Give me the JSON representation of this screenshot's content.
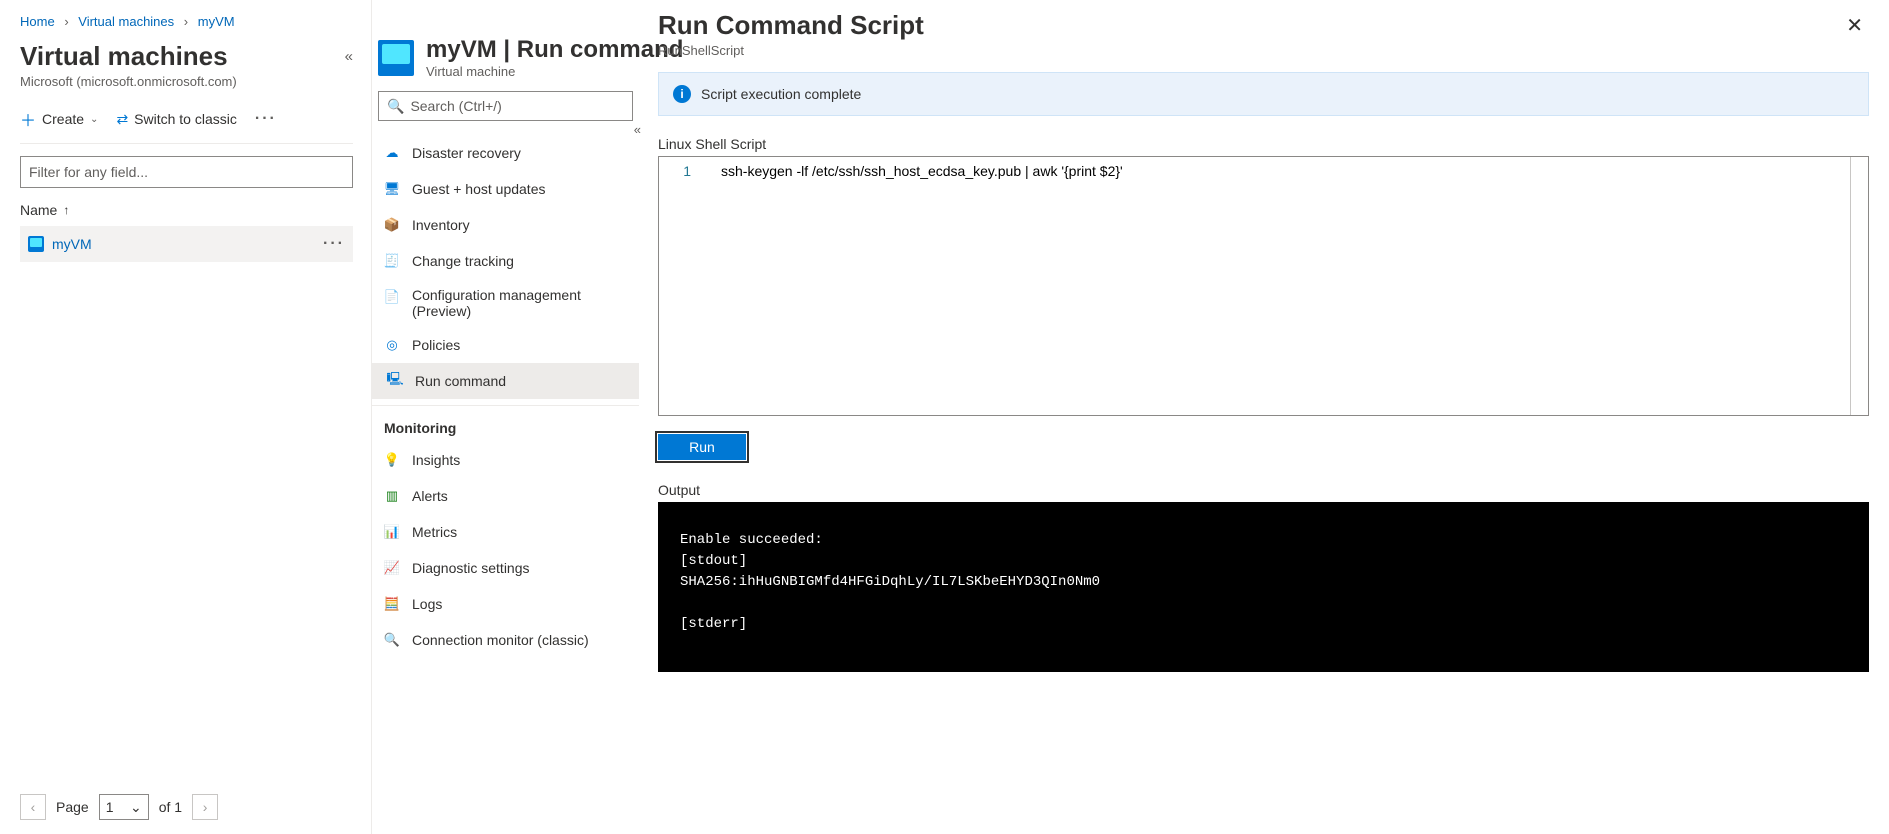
{
  "breadcrumb": {
    "home": "Home",
    "vms": "Virtual machines",
    "vm": "myVM"
  },
  "vmlist": {
    "title": "Virtual machines",
    "subtitle": "Microsoft (microsoft.onmicrosoft.com)",
    "toolbar": {
      "create": "Create",
      "switch": "Switch to classic"
    },
    "filter_placeholder": "Filter for any field...",
    "column": "Name",
    "rows": [
      {
        "name": "myVM"
      }
    ],
    "pagination": {
      "page_label": "Page",
      "current": "1",
      "of_label": "of 1"
    }
  },
  "vmblade": {
    "title": "myVM | Run command",
    "subtitle": "Virtual machine",
    "search_placeholder": "Search (Ctrl+/)",
    "nav": {
      "items": [
        {
          "label": "Disaster recovery"
        },
        {
          "label": "Guest + host updates"
        },
        {
          "label": "Inventory"
        },
        {
          "label": "Change tracking"
        },
        {
          "label": "Configuration management (Preview)"
        },
        {
          "label": "Policies"
        },
        {
          "label": "Run command"
        }
      ],
      "section": "Monitoring",
      "mon_items": [
        {
          "label": "Insights"
        },
        {
          "label": "Alerts"
        },
        {
          "label": "Metrics"
        },
        {
          "label": "Diagnostic settings"
        },
        {
          "label": "Logs"
        },
        {
          "label": "Connection monitor (classic)"
        }
      ]
    }
  },
  "runpanel": {
    "title": "Run Command Script",
    "subtitle": "RunShellScript",
    "status": "Script execution complete",
    "script_label": "Linux Shell Script",
    "line_number": "1",
    "script_line": "ssh-keygen -lf /etc/ssh/ssh_host_ecdsa_key.pub | awk '{print $2}'",
    "run_button": "Run",
    "output_label": "Output",
    "output_text": "Enable succeeded: \n[stdout]\nSHA256:ihHuGNBIGMfd4HFGiDqhLy/IL7LSKbeEHYD3QIn0Nm0\n\n[stderr]"
  }
}
